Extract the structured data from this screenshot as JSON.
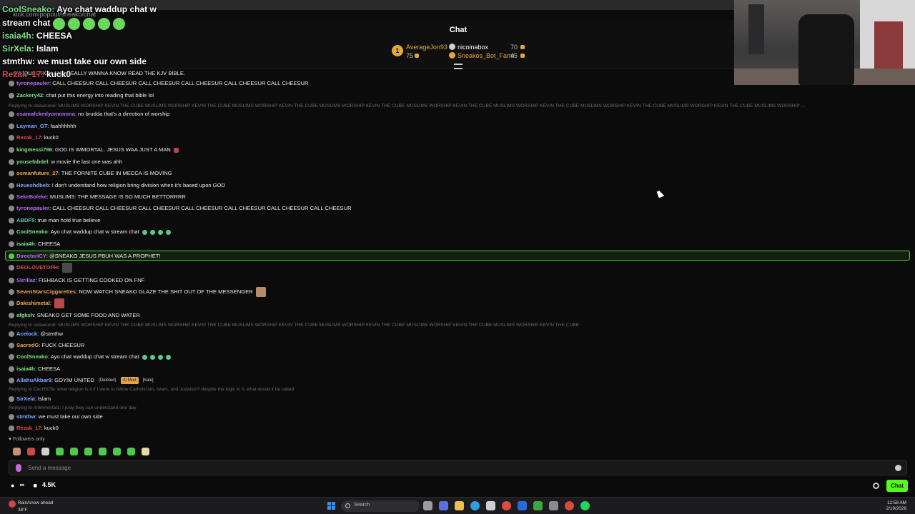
{
  "url": "kick.com/popout/sneako/chat",
  "chat_title": "Chat",
  "leaderboard": {
    "rank_1": "1",
    "top_name": "AverageJon93",
    "top_value": "75",
    "second_name": "nicoinabox",
    "second_value": "70",
    "third_name": "Sneakos_Bot_Farm",
    "third_value": "45"
  },
  "overlay": [
    {
      "user": "CoolSneako:",
      "text": " Ayo chat waddup chat w"
    },
    {
      "user": "",
      "text": "stream chat"
    },
    {
      "user": "isaia4h:",
      "text": " CHEESA"
    },
    {
      "user": "SirXela:",
      "text": " Islam"
    },
    {
      "user": "",
      "text": "stmthw: we must take our own side"
    },
    {
      "user": "Rezak_17:",
      "text": " kuck0"
    }
  ],
  "messages": [
    {
      "user": "",
      "text": "...OW QUESTION AND REALLY WANNA KNOW READ THE KJV BIBLE.",
      "color": "#ececec"
    },
    {
      "user": "tyronepauler",
      "text": ": CALL CHEESUR CALL CHEESUR CALL CHEESUR CALL CHEESUR CALL CHEESUR CALL CHEESUR",
      "color": "#b36bf0"
    },
    {
      "user": "Zackery42",
      "text": ": chat put this energy into reading that bible lol",
      "color": "#7ee08a"
    },
    {
      "reply": "Replying to cklawson6: MUSLIMS WORSHIP KEVIN THE CUBE MUSLIMS WORSHIP KEVIN THE CUBE MUSLIMS WORSHIP KEVIN THE CUBE MUSLIMS WORSHIP KEVIN THE CUBE MUSLIMS WORSHIP KEVIN THE CUBE MUSLIMS WORSHIP KEVIN THE CUBE MUSLIMS WORSHIP KEVIN THE CUBE MUSLIMS WORSHIP KEVIN THE CUBE MUSLIMS WORSHIP ..."
    },
    {
      "user": "osamafckedyomomma",
      "text": ": no brudda that's a direction of worship",
      "color": "#b36bf0"
    },
    {
      "user": "Layman_GT",
      "text": ": faahhhhhh",
      "color": "#7fa7ff"
    },
    {
      "user": "Rezak_17",
      "text": ": kuck0",
      "color": "#d84a4a"
    },
    {
      "user": "kingmessi786",
      "text": ": GOD IS IMMORTAL. JESUS WAA JUST A MAN",
      "color": "#7ee08a"
    },
    {
      "user": "yousefabdel",
      "text": ": w movie the last one was ahh",
      "color": "#7ee08a"
    },
    {
      "user": "osmanfuture_27",
      "text": ": THE FORNITE CUBE IN MECCA IS MOVING",
      "color": "#e8a64b"
    },
    {
      "user": "Heueshdbeb",
      "text": ": I don't understand how religion bring division when it's based upon GOD",
      "color": "#7fa7ff"
    },
    {
      "user": "SekeBoleke",
      "text": ": MUSLIMS: THE MESSAGE IS SO MUCH BETTORRRR",
      "color": "#b36bf0"
    },
    {
      "user": "tyronepauler",
      "text": ": CALL CHEESUR CALL CHEESUR CALL CHEESUR CALL CHEESUR CALL CHEESUR CALL CHEESUR CALL CHEESUR",
      "color": "#b36bf0"
    },
    {
      "user": "ABDF5",
      "text": ": true man hold true believe",
      "color": "#5ec8a8"
    },
    {
      "user": "CoolSneako",
      "text": ": Ayo chat waddup chat w stream chat",
      "color": "#7ee08a"
    },
    {
      "user": "isaia4h",
      "text": ": CHEESA",
      "color": "#7ee08a"
    },
    {
      "user": "DirectorICY",
      "text": ": @SNEAKO JESUS PBUH WAS A PROPHET!",
      "color": "#b36bf0"
    },
    {
      "user": "DEOLOVETOPH",
      "text": ":",
      "color": "#d84a4a"
    },
    {
      "user": "Skrillaz",
      "text": ": FISHBACK IS GETTING COOKED ON FNF",
      "color": "#b36bf0"
    },
    {
      "user": "SevenStarsCiggarettes",
      "text": ": NOW WATCH SNEAKO GLAZE THE SHIT OUT OF THE MESSENGER",
      "color": "#e8a64b"
    },
    {
      "user": "Dakishimetal",
      "text": ":",
      "color": "#e8a64b"
    },
    {
      "user": "afgksh",
      "text": ": SNEAKO GET SOME FOOD AND WATER",
      "color": "#7ee08a"
    },
    {
      "reply": "Replying to cklawson6: MUSLIMS WORSHIP KEVIN THE CUBE MUSLIMS WORSHIP KEVIN THE CUBE MUSLIMS WORSHIP KEVIN THE CUBE MUSLIMS WORSHIP KEVIN THE CUBE MUSLIMS WORSHIP KEVIN THE CUBE MUSLIMS WORSHIP KEVIN THE CUBE"
    },
    {
      "user": "Acelock",
      "text": ": @stmthw",
      "color": "#7fa7ff"
    },
    {
      "user": "SacredG",
      "text": ": FUCK CHEESUR",
      "color": "#e8a64b"
    },
    {
      "user": "CoolSneako",
      "text": ": Ayo chat waddup chat w stream chat",
      "color": "#7ee08a"
    },
    {
      "user": "isaia4h",
      "text": ": CHEESA",
      "color": "#7ee08a"
    },
    {
      "user": "AllahuAkbar9",
      "text": ": GOYIM UNITED",
      "color": "#7fa7ff",
      "tags": [
        "(Deleted)",
        "AI Mod",
        "[hate]"
      ]
    },
    {
      "reply": "Replying to CocHXiTe: what religion is it if I were to follow Catholicism, Islam, and Judaism? despite the logic in it, what would it be called"
    },
    {
      "user": "SirXela",
      "text": ": Islam",
      "color": "#7fa7ff"
    },
    {
      "reply": "Replying to mrimmortal1: I pray they can understand one day"
    },
    {
      "user": "stmthw",
      "text": ": we must take our own side",
      "color": "#7fa7ff"
    },
    {
      "user": "Rezak_17",
      "text": ": kuck0",
      "color": "#d84a4a"
    }
  ],
  "followers_only": "Followers only",
  "input": {
    "placeholder": "Send a message"
  },
  "footer": {
    "infinity": "∞",
    "viewers": "4.5K",
    "chat_button": "Chat"
  },
  "taskbar": {
    "weather_title": "Rain/snow ahead",
    "weather_temp": "38°F",
    "search": "Search",
    "time": "12:58 AM",
    "date": "2/19/2026"
  },
  "colors": {
    "accent": "#53fc18",
    "highlight_border": "#4fd13b"
  }
}
